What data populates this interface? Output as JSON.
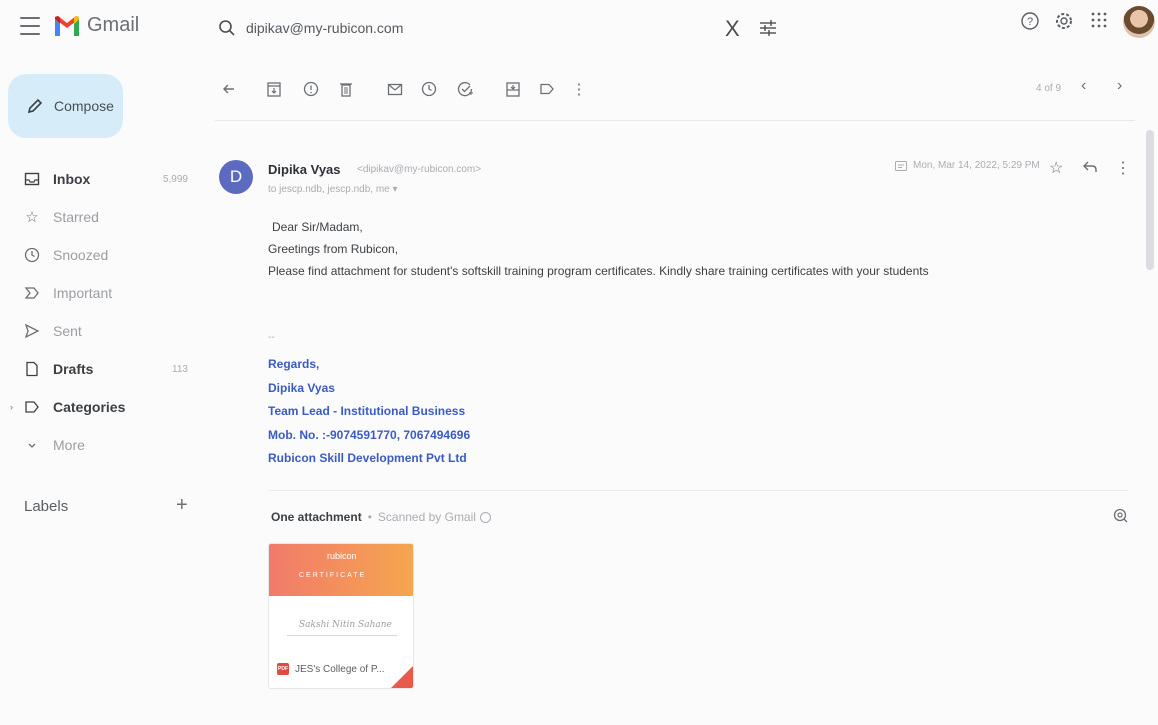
{
  "app": {
    "name": "Gmail"
  },
  "search": {
    "value": "dipikav@my-rubicon.com",
    "clear_label": "X"
  },
  "compose": {
    "label": "Compose"
  },
  "sidebar": {
    "items": [
      {
        "label": "Inbox",
        "count": "5,999",
        "icon": "inbox-icon"
      },
      {
        "label": "Starred",
        "count": "",
        "icon": "star-icon"
      },
      {
        "label": "Snoozed",
        "count": "",
        "icon": "clock-icon"
      },
      {
        "label": "Important",
        "count": "",
        "icon": "important-icon"
      },
      {
        "label": "Sent",
        "count": "",
        "icon": "send-icon"
      },
      {
        "label": "Drafts",
        "count": "113",
        "icon": "draft-icon"
      },
      {
        "label": "Categories",
        "count": "",
        "icon": "label-icon"
      },
      {
        "label": "More",
        "count": "",
        "icon": "chevron-down-icon"
      }
    ],
    "labels_header": "Labels",
    "labels_add": "+"
  },
  "toolbar": {
    "pager": "4 of 9",
    "prev": "‹",
    "next": "›"
  },
  "message": {
    "avatar_letter": "D",
    "sender_name": "Dipika Vyas",
    "sender_email": "<dipikav@my-rubicon.com>",
    "recipients": "to jescp.ndb, jescp.ndb, me ▾",
    "date": "Mon, Mar 14, 2022, 5:29 PM",
    "body": [
      "Dear Sir/Madam,",
      "Greetings from Rubicon,",
      "Please find attachment for student's softskill training program certificates. Kindly share training certificates with your students"
    ],
    "sig_dash": "--",
    "signature": [
      "Regards,",
      "Dipika Vyas",
      "Team Lead - Institutional Business",
      "Mob. No. :-9074591770, 7067494696",
      "Rubicon Skill Development Pvt Ltd"
    ]
  },
  "attachments": {
    "count_label": "One attachment",
    "separator": "•",
    "scan_label": "Scanned by Gmail",
    "file": {
      "brand": "rubicon",
      "cert_title": "CERTIFICATE",
      "signature_text": "Sakshi Nitin Sahane",
      "pdf_tag": "PDF",
      "name": "JES's College of P..."
    }
  },
  "colors": {
    "compose_bg": "#d6ecf9",
    "avatar_bg": "#5c6bc0",
    "signature": "#3b5bc4",
    "pdf": "#e04a3f"
  }
}
